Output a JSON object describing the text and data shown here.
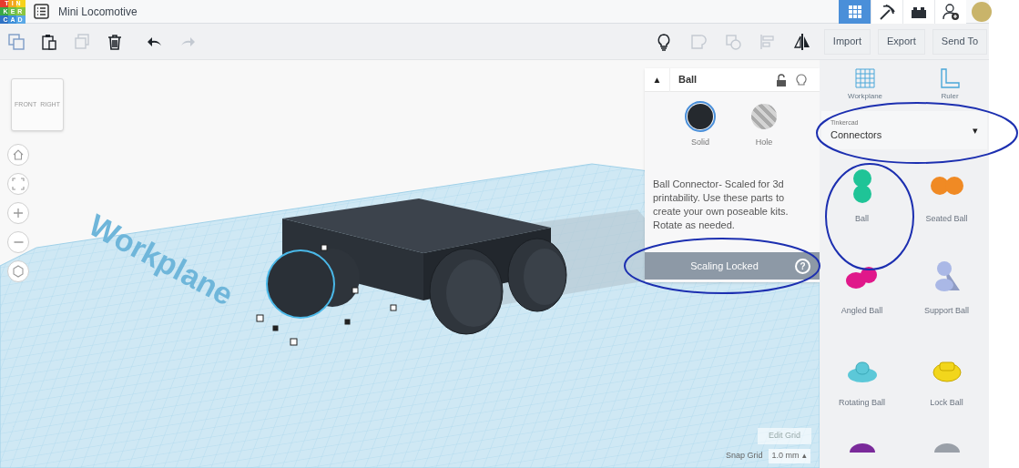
{
  "logo": [
    "TIN",
    "KER",
    "CAD"
  ],
  "title": "Mini Locomotive",
  "header_tools": [
    {
      "kind": "grid",
      "selected": true
    },
    {
      "kind": "pickaxe",
      "selected": false
    },
    {
      "kind": "bricks",
      "selected": false
    },
    {
      "kind": "add-user",
      "selected": false
    }
  ],
  "edit_tools": [
    {
      "kind": "copy",
      "disabled": false
    },
    {
      "kind": "paste",
      "disabled": false
    },
    {
      "kind": "duplicate",
      "disabled": true
    },
    {
      "kind": "delete",
      "disabled": false
    },
    {
      "kind": "undo",
      "disabled": false
    },
    {
      "kind": "redo",
      "disabled": true
    }
  ],
  "shape_tools": [
    {
      "kind": "bulb",
      "disabled": false
    },
    {
      "kind": "group",
      "disabled": true
    },
    {
      "kind": "ungroup",
      "disabled": true
    },
    {
      "kind": "align",
      "disabled": true
    },
    {
      "kind": "mirror",
      "disabled": false
    }
  ],
  "actions": [
    "Import",
    "Export",
    "Send To"
  ],
  "view_cube": [
    "FRONT",
    "RIGHT"
  ],
  "view_controls": [
    {
      "kind": "home"
    },
    {
      "kind": "fit"
    },
    {
      "kind": "zoom-in"
    },
    {
      "kind": "zoom-out"
    },
    {
      "kind": "perspective"
    }
  ],
  "workplane": {
    "watermark": "Workplane",
    "edit_grid": "Edit Grid",
    "snap_label": "Snap Grid",
    "snap_value": "1.0 mm",
    "snap_caret": "▴"
  },
  "inspector": {
    "collapse": "▲",
    "title": "Ball",
    "locked": false,
    "modes": [
      {
        "label": "Solid",
        "selected": true
      },
      {
        "label": "Hole",
        "selected": false
      }
    ],
    "description": "Ball Connector- Scaled for 3d printability. Use these parts to create your own poseable kits. Rotate as needed.",
    "scaling": "Scaling Locked",
    "help": "?"
  },
  "library": {
    "tools": [
      {
        "kind": "workplane",
        "label": "Workplane"
      },
      {
        "kind": "ruler",
        "label": "Ruler"
      }
    ],
    "dropdown": {
      "label": "Tinkercad",
      "value": "Connectors",
      "caret": "▾"
    },
    "shapes": [
      {
        "kind": "ball",
        "label": "Ball",
        "color": "#1fc497"
      },
      {
        "kind": "seated",
        "label": "Seated Ball",
        "color": "#f08a24"
      },
      {
        "kind": "angled",
        "label": "Angled Ball",
        "color": "#e0188a"
      },
      {
        "kind": "support",
        "label": "Support Ball",
        "color": "#aab8e6"
      },
      {
        "kind": "rotating",
        "label": "Rotating Ball",
        "color": "#5cc8d8"
      },
      {
        "kind": "lock",
        "label": "Lock Ball",
        "color": "#f2d61c"
      },
      {
        "kind": "partial",
        "color": "#7a2a9a"
      },
      {
        "kind": "partial",
        "color": "#9aa0a8"
      }
    ]
  }
}
